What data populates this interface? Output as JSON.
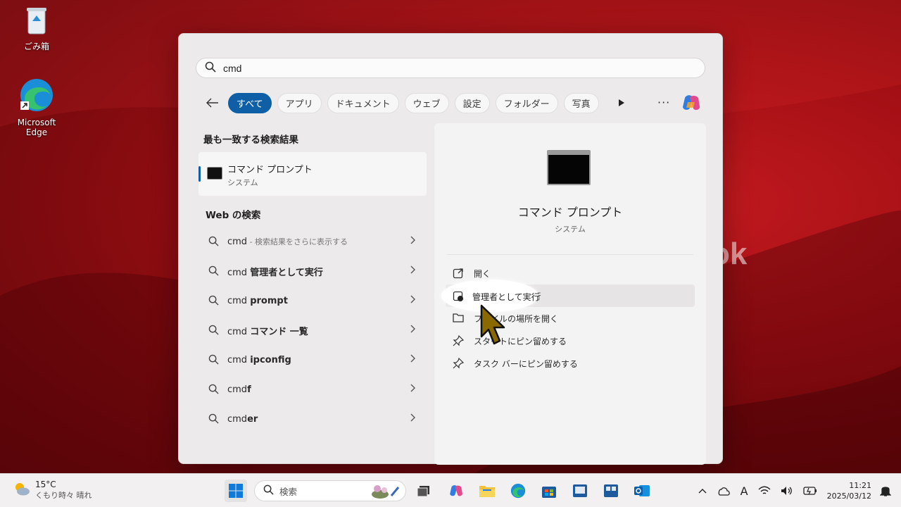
{
  "desktop": {
    "recycle_bin_label": "ごみ箱",
    "edge_label": "Microsoft Edge",
    "background_text": "ok"
  },
  "search": {
    "query": "cmd",
    "filters": [
      {
        "label": "すべて",
        "active": true
      },
      {
        "label": "アプリ"
      },
      {
        "label": "ドキュメント"
      },
      {
        "label": "ウェブ"
      },
      {
        "label": "設定"
      },
      {
        "label": "フォルダー"
      },
      {
        "label": "写真"
      }
    ],
    "more_label": "···"
  },
  "best_match": {
    "section_title": "最も一致する検索結果",
    "name": "コマンド プロンプト",
    "type": "システム"
  },
  "web": {
    "section_title": "Web の検索",
    "items": [
      {
        "prefix": "cmd",
        "bold": "",
        "hint": " - 検索結果をさらに表示する"
      },
      {
        "prefix": "cmd ",
        "bold": "管理者として実行",
        "hint": ""
      },
      {
        "prefix": "cmd ",
        "bold": "prompt",
        "hint": ""
      },
      {
        "prefix": "cmd ",
        "bold": "コマンド 一覧",
        "hint": ""
      },
      {
        "prefix": "cmd ",
        "bold": "ipconfig",
        "hint": ""
      },
      {
        "prefix": "cmd",
        "bold": "f",
        "hint": ""
      },
      {
        "prefix": "cmd",
        "bold": "er",
        "hint": ""
      }
    ]
  },
  "detail": {
    "title": "コマンド プロンプト",
    "subtitle": "システム",
    "actions": [
      {
        "label": "開く",
        "icon": "open-icon"
      },
      {
        "label": "管理者として実行",
        "icon": "shield-icon"
      },
      {
        "label": "ファイルの場所を開く",
        "icon": "folder-icon"
      },
      {
        "label": "スタートにピン留めする",
        "icon": "pin-icon"
      },
      {
        "label": "タスク バーにピン留めする",
        "icon": "pin-icon"
      }
    ]
  },
  "taskbar": {
    "weather_temp": "15°C",
    "weather_desc": "くもり時々 晴れ",
    "search_placeholder": "検索",
    "time": "11:21",
    "date": "2025/03/12",
    "ime": "A"
  },
  "colors": {
    "accent": "#0f5fa6",
    "desktop": "#a20f14"
  }
}
